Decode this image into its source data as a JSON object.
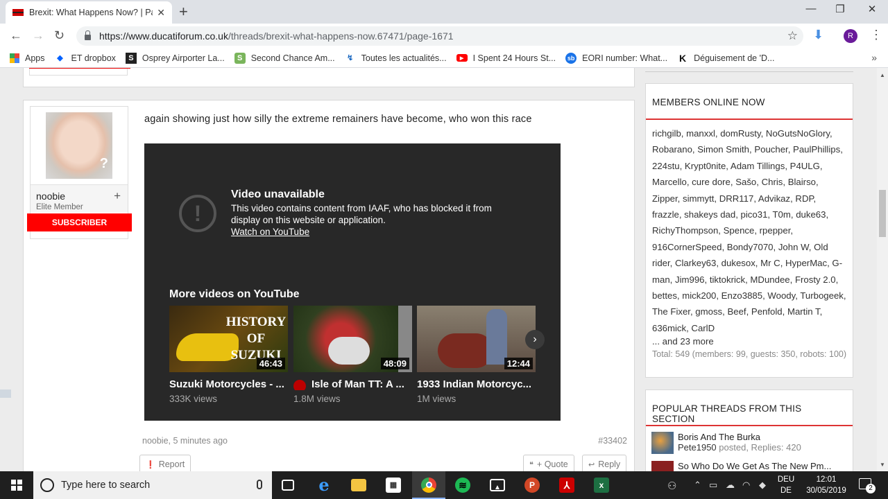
{
  "browser": {
    "tab_title": "Brexit: What Happens Now? | Pag",
    "url_host": "https://www.ducatiforum.co.uk",
    "url_path": "/threads/brexit-what-happens-now.67471/page-1671",
    "profile_initial": "R",
    "bookmarks": [
      {
        "label": "Apps",
        "icon": "apps-grid-icon"
      },
      {
        "label": "ET dropbox",
        "icon": "dropbox-icon"
      },
      {
        "label": "Osprey Airporter La...",
        "icon": "s-logo-icon"
      },
      {
        "label": "Second Chance Am...",
        "icon": "shopify-icon"
      },
      {
        "label": "Toutes les actualités...",
        "icon": "news-icon"
      },
      {
        "label": "I Spent 24 Hours St...",
        "icon": "youtube-icon"
      },
      {
        "label": "EORI number: What...",
        "icon": "sb-icon"
      },
      {
        "label": "Déguisement de 'D...",
        "icon": "k-logo-icon"
      }
    ]
  },
  "post": {
    "username": "noobie",
    "user_title": "Elite Member",
    "subscriber_label": "SUBSCRIBER",
    "text": "again showing just how silly the extreme remainers have become, who won this race",
    "meta": "noobie, 5 minutes ago",
    "number": "#33402",
    "report_label": "Report",
    "quote_label": "+ Quote",
    "reply_label": "Reply"
  },
  "video": {
    "unavailable_title": "Video unavailable",
    "unavailable_msg": "This video contains content from IAAF, who has blocked it from display on this website or application.",
    "watch_link": "Watch on YouTube",
    "more_title": "More videos on YouTube",
    "items": [
      {
        "title": "Suzuki Motorcycles - ...",
        "views": "333K views",
        "duration": "46:43",
        "thumb_text": "HISTORY OF SUZUKI"
      },
      {
        "title": "Isle of Man TT: A ...",
        "views": "1.8M views",
        "duration": "48:09"
      },
      {
        "title": "1933 Indian Motorcyc...",
        "views": "1M views",
        "duration": "12:44"
      }
    ]
  },
  "sidebar": {
    "members_heading": "MEMBERS ONLINE NOW",
    "members_list": "richgilb, manxxl, domRusty, NoGutsNoGlory, Robarano, Simon Smith, Poucher, PaulPhillips, 224stu, Krypt0nite, Adam Tillings, P4ULG, Marcello, cure dore, Sašo, Chris, Blairso, Zipper, simmytt, DRR117, Advikaz, RDP, frazzle, shakeys dad, pico31, T0m, duke63, RichyThompson, Spence, rpepper, 916CornerSpeed, Bondy7070, John W, Old rider, Clarkey63, dukesox, Mr C, HyperMac, G-man, Jim996, tiktokrick, MDundee, Frosty 2.0, bettes, mick200, Enzo3885, Woody, Turbogeek, The Fixer, gmoss, Beef, Penfold, Martin T, 636mick, CarlD",
    "members_more": "... and 23 more",
    "members_total": "Total: 549 (members: 99, guests: 350, robots: 100)",
    "popular_heading": "POPULAR THREADS FROM THIS SECTION",
    "popular": [
      {
        "title": "Boris And The Burka",
        "author": "Pete1950",
        "posted": "posted, Replies: 420"
      },
      {
        "title": "So Who Do We Get As The New Pm...",
        "author": "",
        "posted": ""
      }
    ]
  },
  "taskbar": {
    "search_placeholder": "Type here to search",
    "lang_line1": "DEU",
    "lang_line2": "DE",
    "time": "12:01",
    "date": "30/05/2019",
    "notif_count": "2"
  }
}
